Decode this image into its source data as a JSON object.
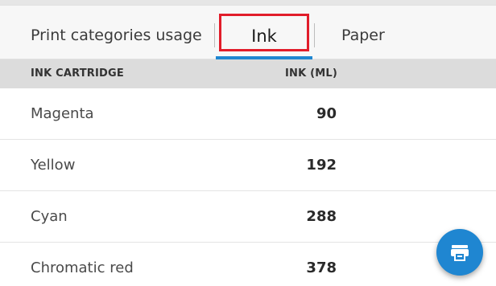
{
  "tabs": {
    "categories": "Print categories usage",
    "ink": "Ink",
    "paper": "Paper",
    "selected": "Ink"
  },
  "table": {
    "headers": [
      "INK CARTRIDGE",
      "INK (ML)"
    ],
    "rows": [
      {
        "name": "Magenta",
        "ink": "90"
      },
      {
        "name": "Yellow",
        "ink": "192"
      },
      {
        "name": "Cyan",
        "ink": "288"
      },
      {
        "name": "Chromatic red",
        "ink": "378"
      }
    ]
  },
  "fab": {
    "icon": "printer-icon"
  },
  "colors": {
    "accent": "#1f86d1",
    "highlight": "#e11d2a",
    "header_bg": "#dcdcdc",
    "tab_bar_bg": "#f7f7f7"
  }
}
